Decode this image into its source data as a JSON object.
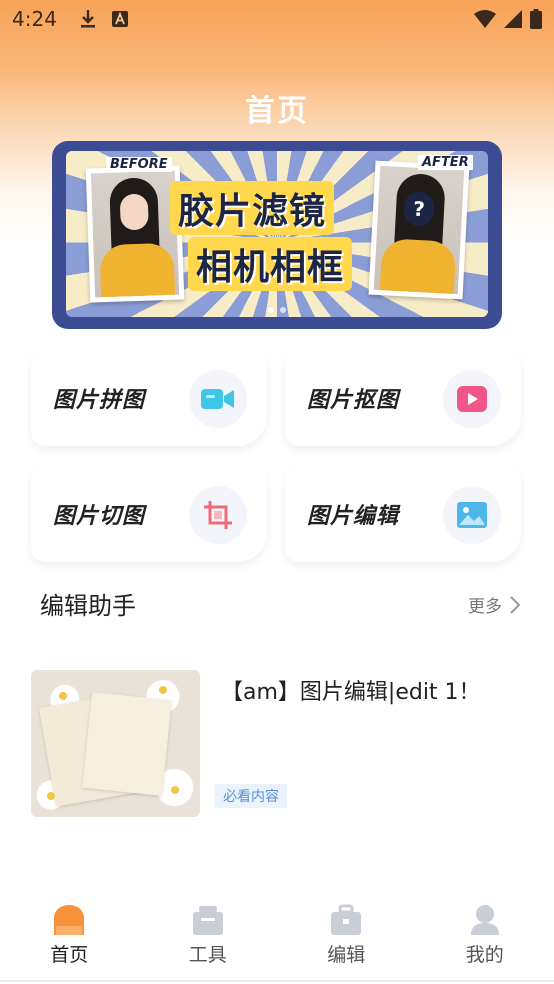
{
  "status_bar": {
    "time": "4:24"
  },
  "header": {
    "title": "首页"
  },
  "banner": {
    "title_line1": "胶片滤镜",
    "title_line2": "相机相框",
    "before_label": "BEFORE",
    "after_label": "AFTER"
  },
  "tools": [
    {
      "label": "图片拼图",
      "icon": "video-camera-icon",
      "color": "#3ec6e6"
    },
    {
      "label": "图片抠图",
      "icon": "play-icon",
      "color": "#f0568a"
    },
    {
      "label": "图片切图",
      "icon": "crop-icon",
      "color": "#f06a78"
    },
    {
      "label": "图片编辑",
      "icon": "image-icon",
      "color": "#4cb7ea"
    }
  ],
  "section": {
    "title": "编辑助手",
    "more_label": "更多"
  },
  "articles": [
    {
      "title": "【am】图片编辑|edit 1！",
      "badge": "必看内容"
    }
  ],
  "tabbar": {
    "items": [
      {
        "label": "首页",
        "icon": "home-icon",
        "active": true
      },
      {
        "label": "工具",
        "icon": "toolbox-icon",
        "active": false
      },
      {
        "label": "编辑",
        "icon": "briefcase-icon",
        "active": false
      },
      {
        "label": "我的",
        "icon": "user-icon",
        "active": false
      }
    ],
    "active_color": "#f7923a",
    "inactive_color": "#c9cdd6"
  }
}
